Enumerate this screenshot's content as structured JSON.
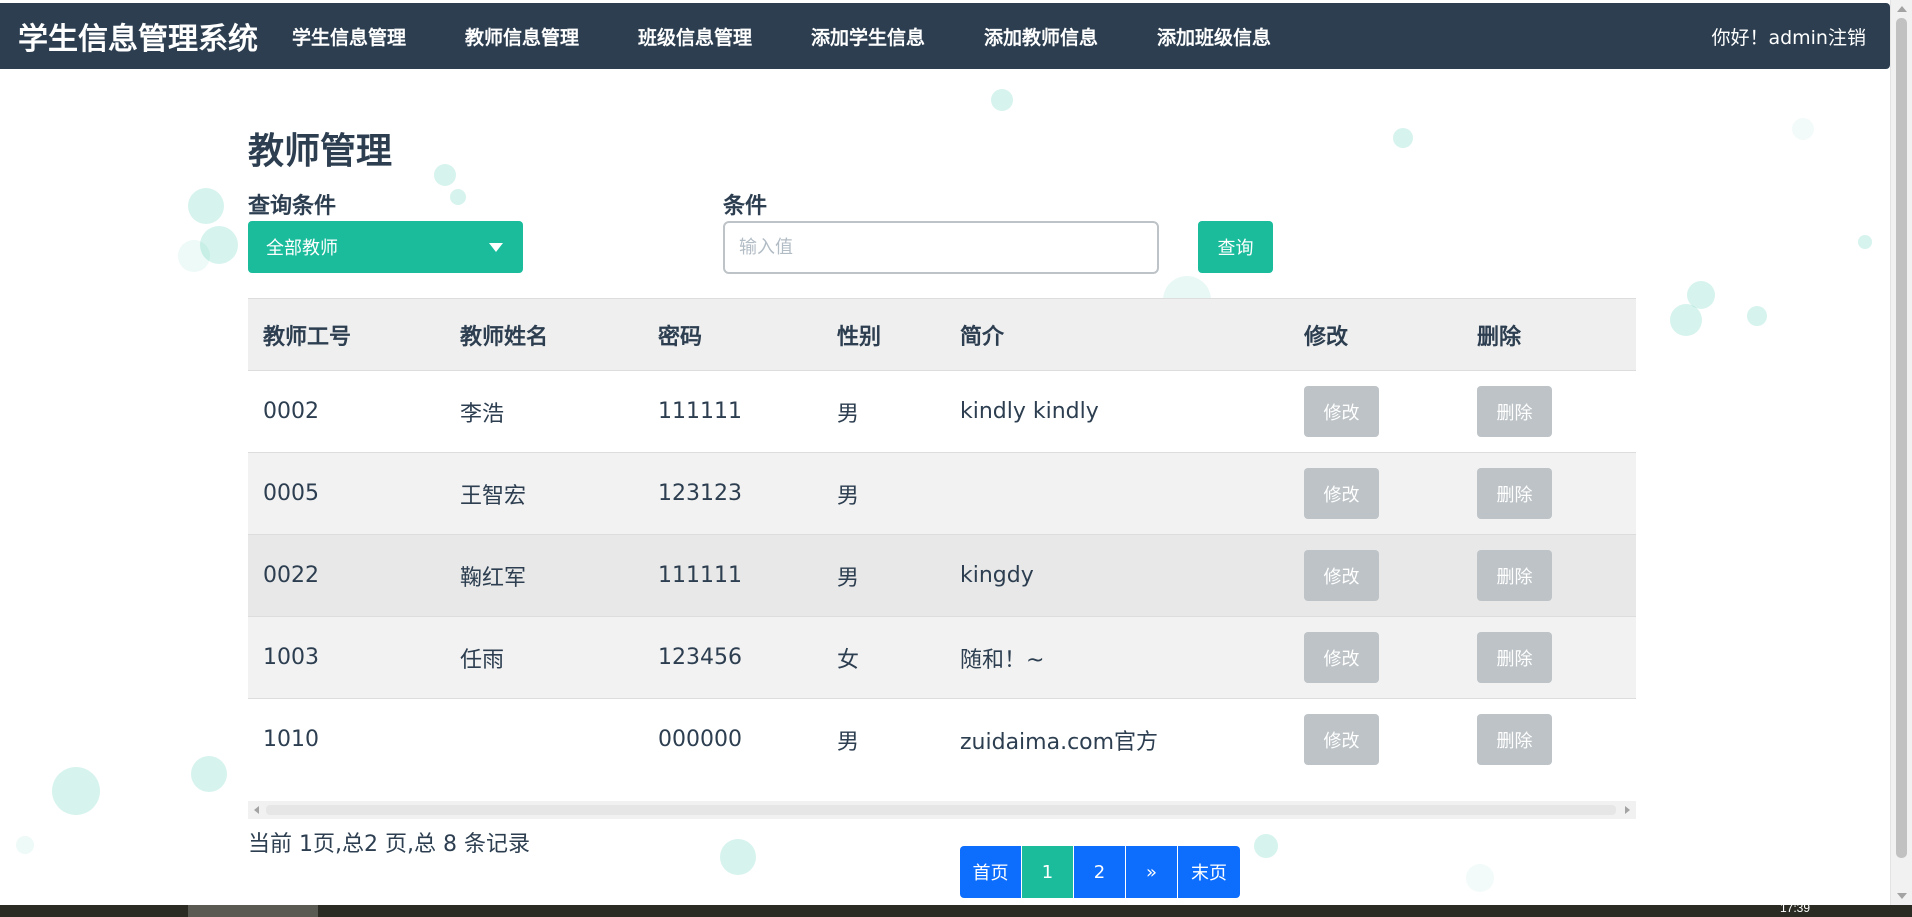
{
  "navbar": {
    "brand": "学生信息管理系统",
    "links": [
      "学生信息管理",
      "教师信息管理",
      "班级信息管理",
      "添加学生信息",
      "添加教师信息",
      "添加班级信息"
    ],
    "greeting": "你好！admin",
    "logout": "注销"
  },
  "page": {
    "title": "教师管理"
  },
  "search": {
    "condition_label": "查询条件",
    "condition_value": "全部教师",
    "value_label": "条件",
    "placeholder": "输入值",
    "value": "",
    "button": "查询"
  },
  "table": {
    "headers": [
      "教师工号",
      "教师姓名",
      "密码",
      "性别",
      "简介",
      "修改",
      "删除"
    ],
    "rows": [
      {
        "id": "0002",
        "name": "李浩",
        "password": "111111",
        "gender": "男",
        "bio": "kindly kindly",
        "edit": "修改",
        "delete": "删除"
      },
      {
        "id": "0005",
        "name": "王智宏",
        "password": "123123",
        "gender": "男",
        "bio": "",
        "edit": "修改",
        "delete": "删除"
      },
      {
        "id": "0022",
        "name": "鞠红军",
        "password": "111111",
        "gender": "男",
        "bio": "kingdy",
        "edit": "修改",
        "delete": "删除"
      },
      {
        "id": "1003",
        "name": "任雨",
        "password": "123456",
        "gender": "女",
        "bio": "随和！~",
        "edit": "修改",
        "delete": "删除"
      },
      {
        "id": "1010",
        "name": "",
        "password": "000000",
        "gender": "男",
        "bio": "zuidaima.com官方",
        "edit": "修改",
        "delete": "删除"
      }
    ]
  },
  "records": "当前 1页,总2 页,总 8 条记录",
  "pagination": {
    "first": "首页",
    "pages": [
      "1",
      "2"
    ],
    "current": "1",
    "next": "»",
    "last": "末页"
  },
  "taskbar": {
    "clock": "17:39"
  },
  "colors": {
    "navbar": "#2c3e50",
    "accent": "#1abc9c",
    "pagination": "#0d6efd",
    "disabled_button": "#bdc3c7"
  }
}
